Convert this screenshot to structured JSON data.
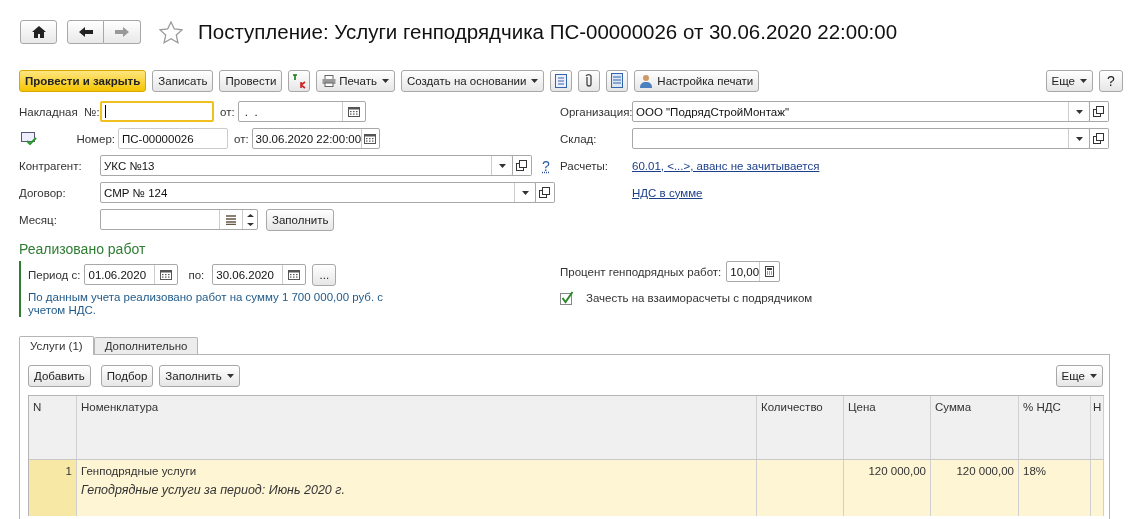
{
  "header": {
    "title": "Поступление: Услуги генподрядчика ПС-00000026 от 30.06.2020 22:00:00"
  },
  "toolbar": {
    "post_close": "Провести и закрыть",
    "save": "Записать",
    "post": "Провести",
    "print": "Печать",
    "create_based": "Создать на основании",
    "print_settings": "Настройка печати",
    "more": "Еще",
    "help": "?"
  },
  "invoice": {
    "label": "Накладная  №:",
    "focused": true,
    "date_label": "от:",
    "date_value": " .  ."
  },
  "number": {
    "label": "Номер:",
    "value": "ПС-00000026",
    "date_label": "от:",
    "date_value": "30.06.2020 22:00:00"
  },
  "counterparty": {
    "label": "Контрагент:",
    "value": "УКС №13",
    "help": "?"
  },
  "contract": {
    "label": "Договор:",
    "value": "СМР № 124"
  },
  "month": {
    "label": "Месяц:",
    "fill_button": "Заполнить"
  },
  "organization": {
    "label": "Организация:",
    "value": "ООО \"ПодрядСтройМонтаж\""
  },
  "warehouse": {
    "label": "Склад:"
  },
  "settlements": {
    "label": "Расчеты:",
    "link": "60.01, <...>, аванс не зачитывается"
  },
  "vat_link": "НДС в сумме",
  "works": {
    "title": "Реализовано работ",
    "from_label": "Период с:",
    "from": "01.06.2020",
    "to_label": "по:",
    "to": "30.06.2020",
    "more": "...",
    "info": "По данным учета реализовано работ на сумму 1 700 000,00 руб. с учетом НДС.",
    "percent_label": "Процент генподрядных работ:",
    "percent": "10,00",
    "offset": {
      "label": "Зачесть на взаиморасчеты с подрядчиком",
      "checked": true
    }
  },
  "tabs": [
    {
      "label": "Услуги (1)",
      "selected": true
    },
    {
      "label": "Дополнительно",
      "selected": false
    }
  ],
  "table_toolbar": {
    "add": "Добавить",
    "pick": "Подбор",
    "fill": "Заполнить",
    "more": "Еще"
  },
  "table": {
    "columns": [
      "N",
      "Номенклатура",
      "Количество",
      "Цена",
      "Сумма",
      "% НДС",
      "Н"
    ],
    "rows": [
      {
        "n": "1",
        "name": "Генподрядные услуги",
        "description": "Геподрядные услуги за период: Июнь 2020 г.",
        "price": "120 000,00",
        "sum": "120 000,00",
        "vat": "18%",
        "selected": true
      }
    ]
  }
}
